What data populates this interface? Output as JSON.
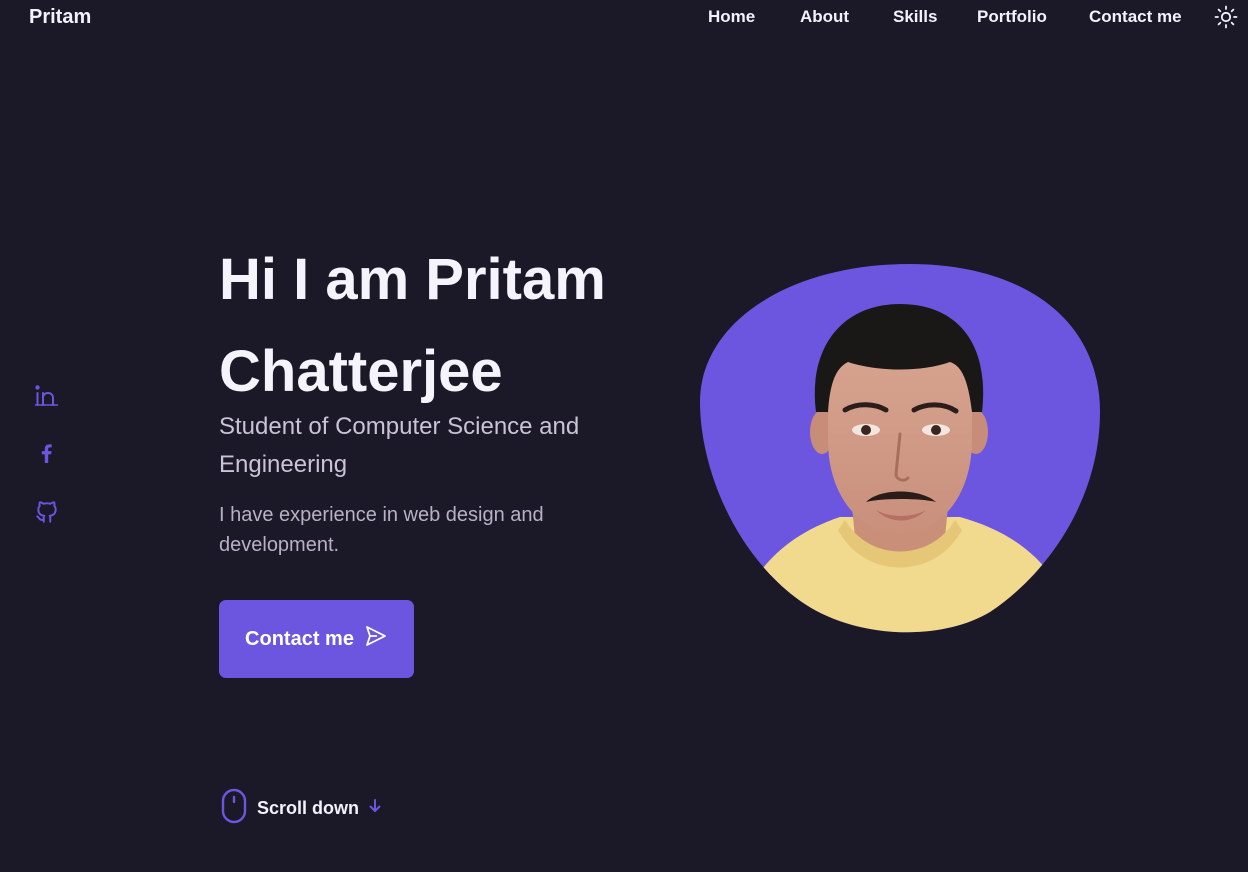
{
  "header": {
    "logo": "Pritam",
    "nav": [
      "Home",
      "About",
      "Skills",
      "Portfolio",
      "Contact me"
    ],
    "theme_toggle_icon": "sun-icon"
  },
  "social": [
    {
      "name": "linkedin",
      "icon": "linkedin-icon"
    },
    {
      "name": "facebook",
      "icon": "facebook-icon"
    },
    {
      "name": "github",
      "icon": "github-icon"
    }
  ],
  "hero": {
    "title_line1": "Hi I am Pritam",
    "title_line2": "Chatterjee",
    "subtitle": "Student of Computer Science and Engineering",
    "description": "I have experience in web design and development.",
    "button_label": "Contact me",
    "button_icon": "send-icon"
  },
  "scroll": {
    "label": "Scroll down",
    "mouse_icon": "mouse-icon",
    "arrow_icon": "arrow-down-icon"
  },
  "colors": {
    "background": "#1b1828",
    "accent": "#6c56e0",
    "text": "#f3f1fa",
    "muted": "#c8c3d6"
  }
}
